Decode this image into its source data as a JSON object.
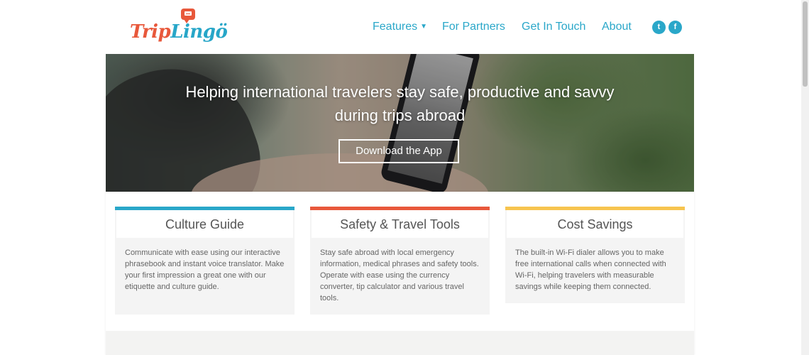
{
  "brand": {
    "logo_part1": "Trip",
    "logo_part2": "Lingö"
  },
  "nav": {
    "features": "Features",
    "partners": "For Partners",
    "contact": "Get In Touch",
    "about": "About",
    "social": [
      "twitter-icon",
      "facebook-icon"
    ]
  },
  "hero": {
    "headline": "Helping international travelers stay safe, productive and savvy during trips abroad",
    "button": "Download the App"
  },
  "cards": [
    {
      "title": "Culture Guide",
      "text": "Communicate with ease using our interactive phrasebook and instant voice translator. Make your first impression a great one with our etiquette and culture guide.",
      "accent": "#2aa7c9"
    },
    {
      "title": "Safety & Travel Tools",
      "text": "Stay safe abroad with local emergency information, medical phrases and safety tools. Operate with ease using the currency converter, tip calculator and various travel tools.",
      "accent": "#e8583b"
    },
    {
      "title": "Cost Savings",
      "text": "The built-in Wi-Fi dialer allows you to make free international calls when connected with Wi-Fi, helping travelers with measurable savings while keeping them connected.",
      "accent": "#f7c44f"
    }
  ],
  "colors": {
    "nav_text": "#2aa7c9",
    "brand_orange": "#e8583b",
    "brand_blue": "#27a6c8"
  }
}
